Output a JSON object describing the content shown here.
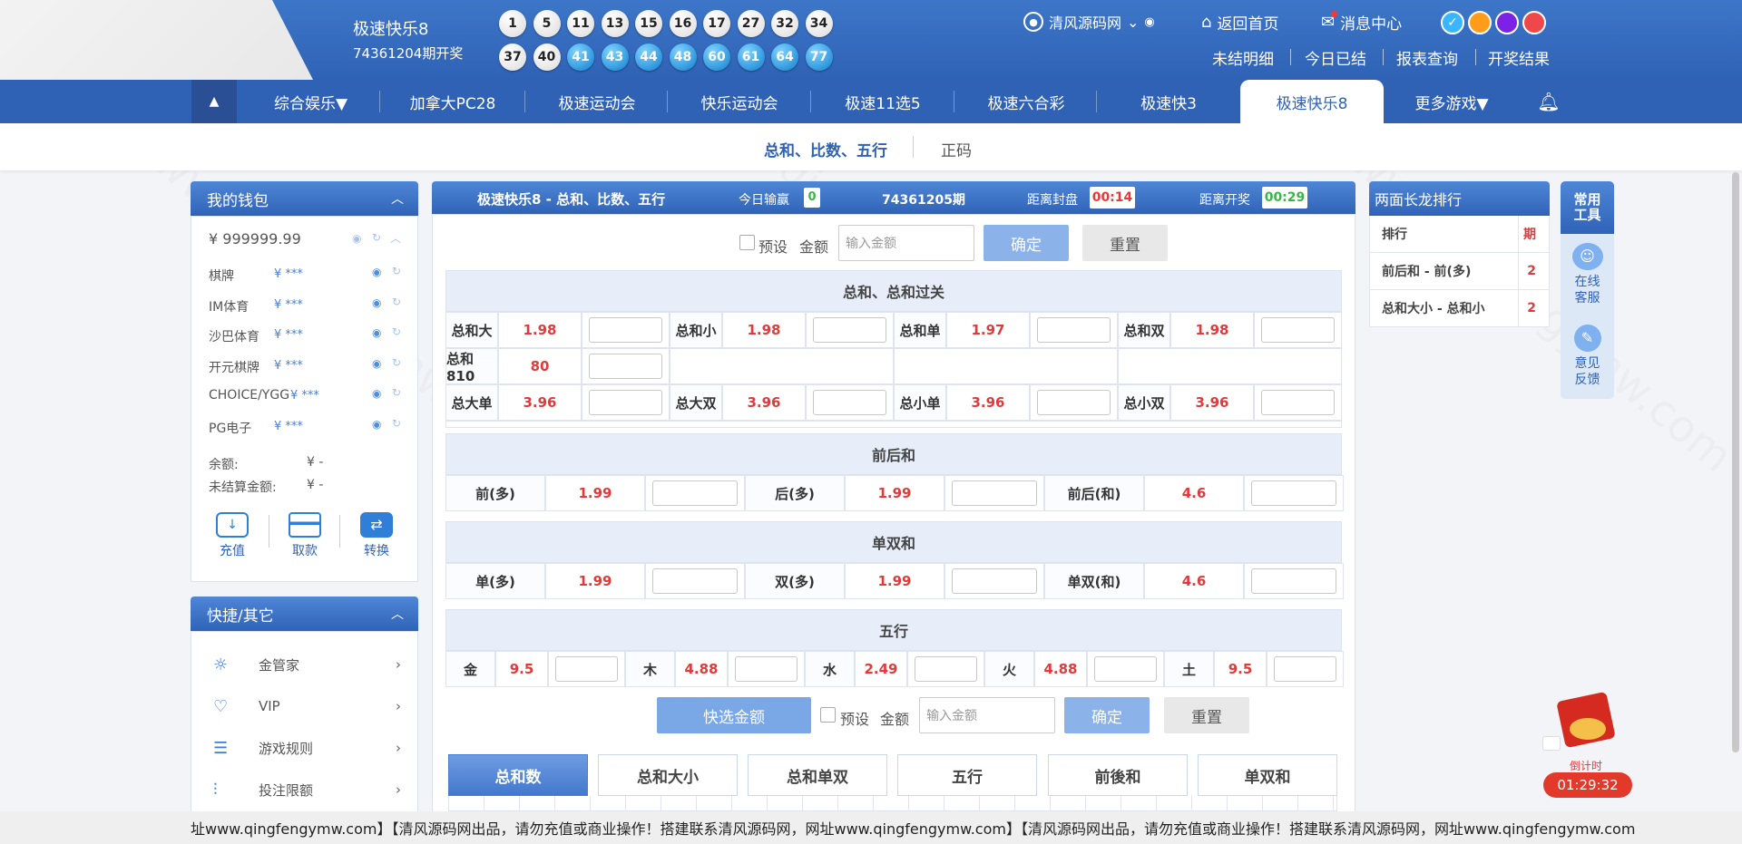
{
  "header": {
    "lottery_name": "极速快乐8",
    "issue_text": "74361204期开奖",
    "balls_row1": [
      "1",
      "5",
      "11",
      "13",
      "15",
      "16",
      "17",
      "27",
      "32",
      "34"
    ],
    "balls_row2": [
      "37",
      "40",
      "41",
      "43",
      "44",
      "48",
      "60",
      "61",
      "64",
      "77"
    ],
    "username": "清风源码网",
    "home": "返回首页",
    "messages": "消息中心",
    "links": [
      "未结明细",
      "今日已结",
      "报表查询",
      "开奖结果"
    ],
    "theme_colors": [
      "#39b6ff",
      "#ff9d1a",
      "#7b22e6",
      "#f0474a"
    ]
  },
  "nav": {
    "items": [
      "综合娱乐▼",
      "加拿大PC28",
      "极速运动会",
      "快乐运动会",
      "极速11选5",
      "极速六合彩",
      "极速快3",
      "极速快乐8",
      "更多游戏▼"
    ],
    "active": "极速快乐8"
  },
  "subtabs": [
    "总和、比数、五行",
    "正码"
  ],
  "wallet": {
    "title": "我的钱包",
    "balance": "¥ 999999.99",
    "accounts": [
      {
        "name": "棋牌",
        "amount": "¥ ***"
      },
      {
        "name": "IM体育",
        "amount": "¥ ***"
      },
      {
        "name": "沙巴体育",
        "amount": "¥ ***"
      },
      {
        "name": "开元棋牌",
        "amount": "¥ ***"
      },
      {
        "name": "CHOICE/YGG",
        "amount": "¥ ***"
      },
      {
        "name": "PG电子",
        "amount": "¥ ***"
      }
    ],
    "remain_label": "余额:",
    "remain_value": "¥ -",
    "unsettled_label": "未结算金额:",
    "unsettled_value": "¥ -",
    "actions": [
      "充值",
      "取款",
      "转换"
    ]
  },
  "quick": {
    "title": "快捷/其它",
    "items": [
      "金管家",
      "VIP",
      "游戏规则",
      "投注限额"
    ]
  },
  "main": {
    "title": "极速快乐8 - 总和、比数、五行",
    "today_label": "今日输赢",
    "today_value": "0",
    "issue": "74361205期",
    "close_label": "距离封盘",
    "close_time": "00:14",
    "open_label": "距离开奖",
    "open_time": "00:29",
    "preset_label": "预设",
    "amount_label": "金额",
    "amount_placeholder": "输入金额",
    "confirm": "确定",
    "reset": "重置",
    "quick_amount": "快选金额",
    "sections": {
      "s1_title": "总和、总和过关",
      "s1_row1": [
        [
          "总和大",
          "1.98"
        ],
        [
          "总和小",
          "1.98"
        ],
        [
          "总和单",
          "1.97"
        ],
        [
          "总和双",
          "1.98"
        ]
      ],
      "s1_row2": [
        [
          "总和810",
          "80"
        ]
      ],
      "s1_row3": [
        [
          "总大单",
          "3.96"
        ],
        [
          "总大双",
          "3.96"
        ],
        [
          "总小单",
          "3.96"
        ],
        [
          "总小双",
          "3.96"
        ]
      ],
      "s2_title": "前后和",
      "s2_row": [
        [
          "前(多)",
          "1.99"
        ],
        [
          "后(多)",
          "1.99"
        ],
        [
          "前后(和)",
          "4.6"
        ]
      ],
      "s3_title": "单双和",
      "s3_row": [
        [
          "单(多)",
          "1.99"
        ],
        [
          "双(多)",
          "1.99"
        ],
        [
          "单双(和)",
          "4.6"
        ]
      ],
      "s4_title": "五行",
      "s4_row": [
        [
          "金",
          "9.5"
        ],
        [
          "木",
          "4.88"
        ],
        [
          "水",
          "2.49"
        ],
        [
          "火",
          "4.88"
        ],
        [
          "土",
          "9.5"
        ]
      ]
    },
    "bottom_tabs": [
      "总和数",
      "总和大小",
      "总和单双",
      "五行",
      "前後和",
      "单双和"
    ]
  },
  "longdragon": {
    "title": "两面长龙排行",
    "head": [
      "排行",
      "期"
    ],
    "rows": [
      [
        "前后和 - 前(多)",
        "2"
      ],
      [
        "总和大小 - 总和小",
        "2"
      ]
    ]
  },
  "tools": {
    "title": "常用工具",
    "items": [
      "在线客服",
      "意见反馈"
    ]
  },
  "countdown": {
    "label": "倒计时",
    "time": "01:29:32"
  },
  "marquee": "址www.qingfengymw.com】【清风源码网出品，请勿充值或商业操作！搭建联系清风源码网，网址www.qingfengymw.com】【清风源码网出品，请勿充值或商业操作！搭建联系清风源码网，网址www.qingfengymw.com"
}
